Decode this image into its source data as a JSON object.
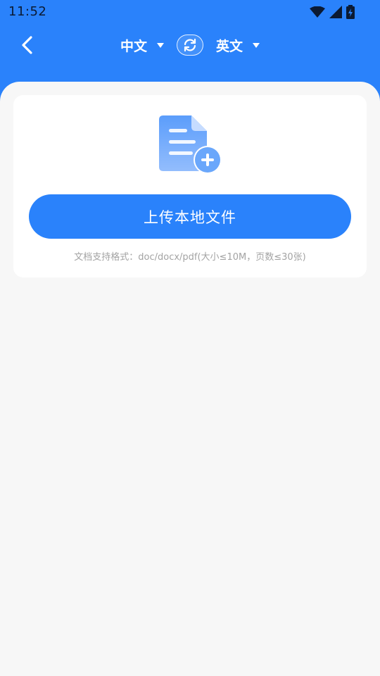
{
  "status_bar": {
    "time": "11:52",
    "icons": [
      "wifi-icon",
      "signal-icon",
      "battery-icon"
    ]
  },
  "nav": {
    "back_icon": "chevron-left-icon",
    "source_language": "中文",
    "target_language": "英文",
    "swap_icon": "swap-icon"
  },
  "upload": {
    "icon": "document-add-icon",
    "button_label": "上传本地文件",
    "format_hint": "文档支持格式：doc/docx/pdf(大小≤10M，页数≤30张)"
  },
  "colors": {
    "primary": "#2a82fb",
    "background": "#f7f7f7",
    "card": "#ffffff",
    "hint_text": "#a3a3a3"
  }
}
